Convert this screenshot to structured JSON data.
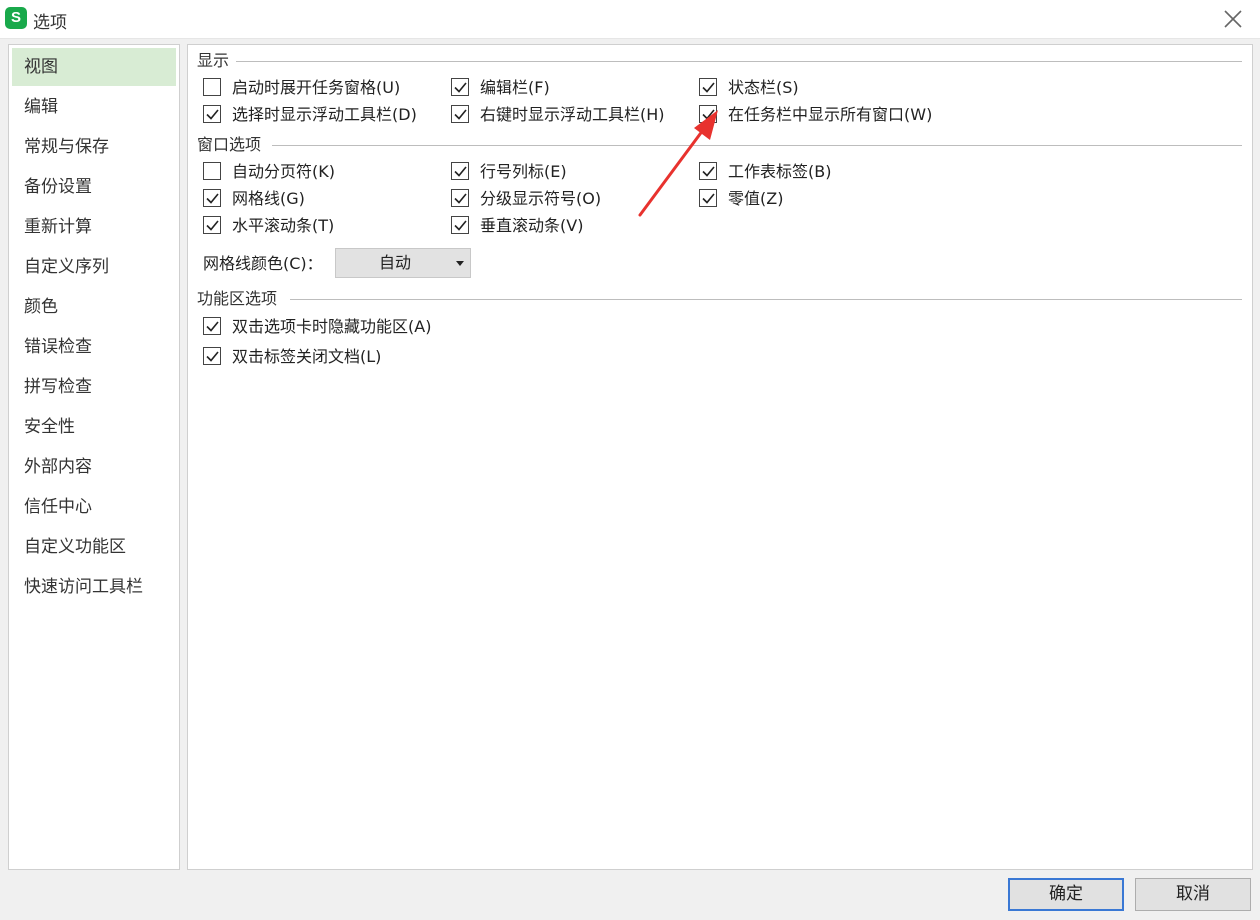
{
  "window": {
    "app_icon_text": "S",
    "title": "选项"
  },
  "sidebar": {
    "items": [
      {
        "label": "视图",
        "active": true
      },
      {
        "label": "编辑"
      },
      {
        "label": "常规与保存"
      },
      {
        "label": "备份设置"
      },
      {
        "label": "重新计算"
      },
      {
        "label": "自定义序列"
      },
      {
        "label": "颜色"
      },
      {
        "label": "错误检查"
      },
      {
        "label": "拼写检查"
      },
      {
        "label": "安全性"
      },
      {
        "label": "外部内容"
      },
      {
        "label": "信任中心"
      },
      {
        "label": "自定义功能区"
      },
      {
        "label": "快速访问工具栏"
      }
    ]
  },
  "display": {
    "title": "显示",
    "options": [
      {
        "label": "启动时展开任务窗格(U)",
        "checked": false
      },
      {
        "label": "编辑栏(F)",
        "checked": true
      },
      {
        "label": "状态栏(S)",
        "checked": true
      },
      {
        "label": "选择时显示浮动工具栏(D)",
        "checked": true
      },
      {
        "label": "右键时显示浮动工具栏(H)",
        "checked": true
      },
      {
        "label": "在任务栏中显示所有窗口(W)",
        "checked": true
      }
    ]
  },
  "window_options": {
    "title": "窗口选项",
    "options": [
      {
        "label": "自动分页符(K)",
        "checked": false
      },
      {
        "label": "行号列标(E)",
        "checked": true
      },
      {
        "label": "工作表标签(B)",
        "checked": true
      },
      {
        "label": "网格线(G)",
        "checked": true
      },
      {
        "label": "分级显示符号(O)",
        "checked": true
      },
      {
        "label": "零值(Z)",
        "checked": true
      },
      {
        "label": "水平滚动条(T)",
        "checked": true
      },
      {
        "label": "垂直滚动条(V)",
        "checked": true
      }
    ],
    "gridline_color_label": "网格线颜色(C)：",
    "gridline_color_value": "自动"
  },
  "ribbon": {
    "title": "功能区选项",
    "options": [
      {
        "label": "双击选项卡时隐藏功能区(A)",
        "checked": true
      },
      {
        "label": "双击标签关闭文档(L)",
        "checked": true
      }
    ]
  },
  "buttons": {
    "ok": "确定",
    "cancel": "取消"
  },
  "annotation": {
    "arrow_color": "#e8322e"
  },
  "colors": {
    "sidebar_active_bg": "#d8ecd4",
    "app_icon_green": "#19a94b",
    "ok_border": "#3a78d4"
  }
}
